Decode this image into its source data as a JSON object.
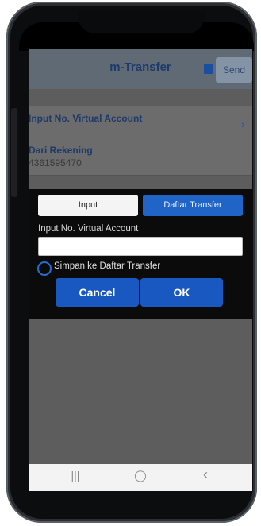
{
  "header": {
    "title": "m-Transfer",
    "send_label": "Send"
  },
  "rows": [
    {
      "label": "Input No. Virtual Account"
    },
    {
      "label": "Dari Rekening",
      "value": "4361595470"
    }
  ],
  "dialog": {
    "tab_input": "Input",
    "tab_daftar": "Daftar Transfer",
    "field_label": "Input No. Virtual Account",
    "field_value": "",
    "radio_label": "Simpan ke Daftar Transfer",
    "cancel_label": "Cancel",
    "ok_label": "OK"
  },
  "navbar": {
    "recent": "|||",
    "home": "◯",
    "back": "‹"
  },
  "colors": {
    "accent": "#1f64c6",
    "dialog_bg": "#0b0b0b",
    "title": "#1d3a6a"
  }
}
